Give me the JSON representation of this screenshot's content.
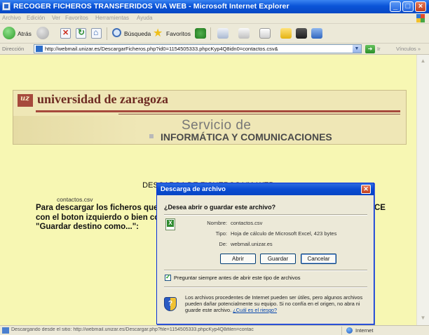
{
  "window": {
    "title": "RECOGER FICHEROS TRANSFERIDOS VIA WEB - Microsoft Internet Explorer"
  },
  "menu": {
    "items": [
      "Archivo",
      "Edición",
      "Ver",
      "Favoritos",
      "Herramientas",
      "Ayuda"
    ]
  },
  "toolbar": {
    "back_label": "Atrás",
    "search_label": "Búsqueda",
    "favorites_label": "Favoritos"
  },
  "address": {
    "label": "Dirección",
    "url": "http://webmail.unizar.es/DescargarFicheros.php?id0=1154505333.phpcKyp4Q8idn0=contactos.csv&",
    "go_label": "Ir",
    "links_label": "Vínculos"
  },
  "banner": {
    "university": "universidad de zaragoza",
    "service_line1": "Servicio de",
    "service_line2": "INFORMÁTICA Y COMUNICACIONES"
  },
  "page": {
    "heading": "DESCARGA DE FICHEROS VIA WEB",
    "intro": "Para descargar los ficheros que le han dejado en este servidor, PULSE SOBRE EL ENLACE con el boton izquierdo o bien con el boton derecho del ratón y seleccionando la opción \"Guardar destino como...\":",
    "file_link": "contactos.csv"
  },
  "dialog": {
    "title": "Descarga de archivo",
    "question": "¿Desea abrir o guardar este archivo?",
    "name_label": "Nombre:",
    "name_value": "contactos.csv",
    "type_label": "Tipo:",
    "type_value": "Hoja de cálculo de Microsoft Excel, 423 bytes",
    "from_label": "De:",
    "from_value": "webmail.unizar.es",
    "open_button": "Abrir",
    "save_button": "Guardar",
    "cancel_button": "Cancelar",
    "always_ask_label": "Preguntar siempre antes de abrir este tipo de archivos",
    "always_ask_checked": true,
    "warning_text": "Los archivos procedentes de Internet pueden ser útiles, pero algunos archivos pueden dañar potencialmente su equipo. Si no confía en el origen, no abra ni guarde este archivo.",
    "warning_link": "¿Cuál es el riesgo?"
  },
  "status": {
    "text": "Descargando desde el sitio: http://webmail.unizar.es/Descargar.php?file=1154505333.phpcKyp4Q8ifilen=contac",
    "zone": "Internet"
  },
  "colors": {
    "page_background": "#f7f7b3",
    "titlebar": "#0a54d8",
    "university_brand": "#6d2a22"
  }
}
